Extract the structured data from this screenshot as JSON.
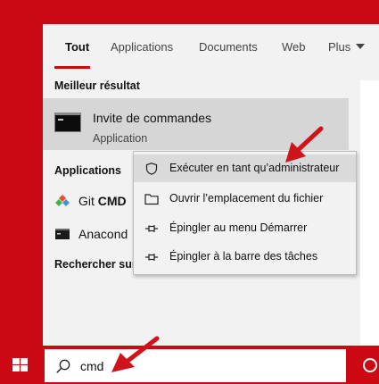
{
  "tabs": [
    {
      "label": "Tout",
      "active": true
    },
    {
      "label": "Applications"
    },
    {
      "label": "Documents"
    },
    {
      "label": "Web"
    },
    {
      "label": "Plus"
    }
  ],
  "best_match": {
    "section_title": "Meilleur résultat",
    "title": "Invite de commandes",
    "subtitle": "Application"
  },
  "apps": {
    "section_title": "Applications",
    "items": [
      {
        "prefix": "Git ",
        "match": "CMD",
        "icon": "git-cmd-icon"
      },
      {
        "prefix": "Anacond",
        "match": "",
        "icon": "anaconda-prompt-icon"
      }
    ]
  },
  "web": {
    "section_title": "Rechercher sur"
  },
  "context_menu": {
    "items": [
      {
        "label": "Exécuter en tant qu’administrateur",
        "icon": "shield-icon",
        "hover": true
      },
      {
        "label": "Ouvrir l’emplacement du fichier",
        "icon": "folder-icon"
      },
      {
        "label": "Épingler au menu Démarrer",
        "icon": "pin-icon"
      },
      {
        "label": "Épingler à la barre des tâches",
        "icon": "pin-icon"
      }
    ]
  },
  "search": {
    "value": "cmd"
  },
  "colors": {
    "accent": "#cc0812",
    "panel_bg": "#f2f2f2",
    "selected_bg": "#d6d6d6",
    "annotation_arrow": "#d0131a"
  }
}
